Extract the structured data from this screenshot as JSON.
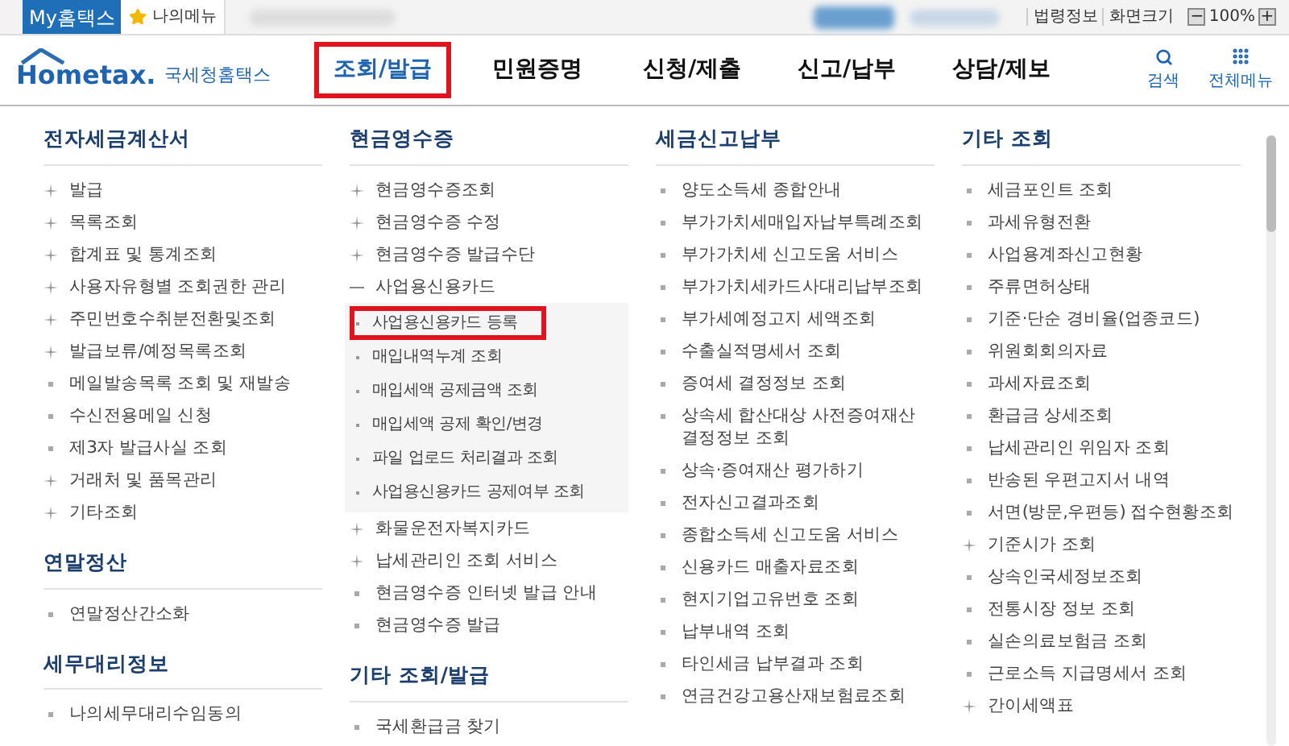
{
  "top_bar": {
    "my_button": "My홈택스",
    "my_menu": "나의메뉴",
    "links": [
      "법령정보",
      "화면크기"
    ],
    "zoom": {
      "minus": "−",
      "value": "100%",
      "plus": "+"
    }
  },
  "header": {
    "logo": {
      "wordmark": "Hometax.",
      "name": "국세청홈택스"
    },
    "nav": [
      {
        "label": "조회/발급",
        "selected": true
      },
      {
        "label": "민원증명",
        "selected": false
      },
      {
        "label": "신청/제출",
        "selected": false
      },
      {
        "label": "신고/납부",
        "selected": false
      },
      {
        "label": "상담/제보",
        "selected": false
      }
    ],
    "tools": [
      {
        "kind": "search",
        "label": "검색"
      },
      {
        "kind": "grid",
        "label": "전체메뉴"
      }
    ]
  },
  "columns": [
    {
      "sections": [
        {
          "title": "전자세금계산서",
          "items": [
            {
              "kind": "folder",
              "label": "발급",
              "expanded": false
            },
            {
              "kind": "folder",
              "label": "목록조회",
              "expanded": false
            },
            {
              "kind": "folder",
              "label": "합계표 및 통계조회",
              "expanded": false
            },
            {
              "kind": "folder",
              "label": "사용자유형별 조회권한 관리",
              "expanded": false
            },
            {
              "kind": "folder",
              "label": "주민번호수취분전환및조회",
              "expanded": false
            },
            {
              "kind": "folder",
              "label": "발급보류/예정목록조회",
              "expanded": false
            },
            {
              "kind": "link",
              "label": "메일발송목록 조회 및 재발송"
            },
            {
              "kind": "link",
              "label": "수신전용메일 신청"
            },
            {
              "kind": "link",
              "label": "제3자 발급사실 조회"
            },
            {
              "kind": "folder",
              "label": "거래처 및 품목관리",
              "expanded": false
            },
            {
              "kind": "folder",
              "label": "기타조회",
              "expanded": false
            }
          ]
        },
        {
          "title": "연말정산",
          "items": [
            {
              "kind": "link",
              "label": "연말정산간소화"
            }
          ]
        },
        {
          "title": "세무대리정보",
          "items": [
            {
              "kind": "link",
              "label": "나의세무대리수임동의"
            }
          ]
        }
      ]
    },
    {
      "sections": [
        {
          "title": "현금영수증",
          "items": [
            {
              "kind": "folder",
              "label": "현금영수증조회",
              "expanded": false
            },
            {
              "kind": "folder",
              "label": "현금영수증 수정",
              "expanded": false
            },
            {
              "kind": "folder",
              "label": "현금영수증 발급수단",
              "expanded": false
            },
            {
              "kind": "folder",
              "label": "사업용신용카드",
              "expanded": true,
              "children": [
                {
                  "label": "사업용신용카드 등록",
                  "selected": true
                },
                {
                  "label": "매입내역누계 조회",
                  "selected": false
                },
                {
                  "label": "매입세액 공제금액 조회",
                  "selected": false
                },
                {
                  "label": "매입세액 공제 확인/변경",
                  "selected": false
                },
                {
                  "label": "파일 업로드 처리결과 조회",
                  "selected": false
                },
                {
                  "label": "사업용신용카드 공제여부 조회",
                  "selected": false
                }
              ]
            },
            {
              "kind": "folder",
              "label": "화물운전자복지카드",
              "expanded": false
            },
            {
              "kind": "folder",
              "label": "납세관리인 조회 서비스",
              "expanded": false
            },
            {
              "kind": "link",
              "label": "현금영수증 인터넷 발급 안내"
            },
            {
              "kind": "link",
              "label": "현금영수증 발급"
            }
          ]
        },
        {
          "title": "기타 조회/발급",
          "items": [
            {
              "kind": "link",
              "label": "국세환급금 찾기"
            }
          ]
        }
      ]
    },
    {
      "sections": [
        {
          "title": "세금신고납부",
          "items": [
            {
              "kind": "link",
              "label": "양도소득세 종합안내"
            },
            {
              "kind": "link",
              "label": "부가가치세매입자납부특례조회"
            },
            {
              "kind": "link",
              "label": "부가가치세 신고도움 서비스"
            },
            {
              "kind": "link",
              "label": "부가가치세카드사대리납부조회"
            },
            {
              "kind": "link",
              "label": "부가세예정고지 세액조회"
            },
            {
              "kind": "link",
              "label": "수출실적명세서 조회"
            },
            {
              "kind": "link",
              "label": "증여세 결정정보 조회"
            },
            {
              "kind": "link",
              "label": "상속세 합산대상 사전증여재산 결정정보 조회"
            },
            {
              "kind": "link",
              "label": "상속·증여재산 평가하기"
            },
            {
              "kind": "link",
              "label": "전자신고결과조회"
            },
            {
              "kind": "link",
              "label": "종합소득세 신고도움 서비스"
            },
            {
              "kind": "link",
              "label": "신용카드 매출자료조회"
            },
            {
              "kind": "link",
              "label": "현지기업고유번호 조회"
            },
            {
              "kind": "link",
              "label": "납부내역 조회"
            },
            {
              "kind": "link",
              "label": "타인세금 납부결과 조회"
            },
            {
              "kind": "link",
              "label": "연금건강고용산재보험료조회"
            }
          ]
        }
      ]
    },
    {
      "sections": [
        {
          "title": "기타 조회",
          "items": [
            {
              "kind": "link",
              "label": "세금포인트 조회"
            },
            {
              "kind": "link",
              "label": "과세유형전환"
            },
            {
              "kind": "link",
              "label": "사업용계좌신고현황"
            },
            {
              "kind": "link",
              "label": "주류면허상태"
            },
            {
              "kind": "link",
              "label": "기준·단순 경비율(업종코드)"
            },
            {
              "kind": "link",
              "label": "위원회회의자료"
            },
            {
              "kind": "link",
              "label": "과세자료조회"
            },
            {
              "kind": "link",
              "label": "환급금 상세조회"
            },
            {
              "kind": "link",
              "label": "납세관리인 위임자 조회"
            },
            {
              "kind": "link",
              "label": "반송된 우편고지서 내역"
            },
            {
              "kind": "link",
              "label": "서면(방문,우편등) 접수현황조회"
            },
            {
              "kind": "folder",
              "label": "기준시가 조회",
              "expanded": false
            },
            {
              "kind": "link",
              "label": "상속인국세정보조회"
            },
            {
              "kind": "link",
              "label": "전통시장 정보 조회"
            },
            {
              "kind": "link",
              "label": "실손의료보험금 조회"
            },
            {
              "kind": "link",
              "label": "근로소득 지급명세서 조회"
            },
            {
              "kind": "folder",
              "label": "간이세액표",
              "expanded": false
            }
          ]
        }
      ]
    }
  ]
}
